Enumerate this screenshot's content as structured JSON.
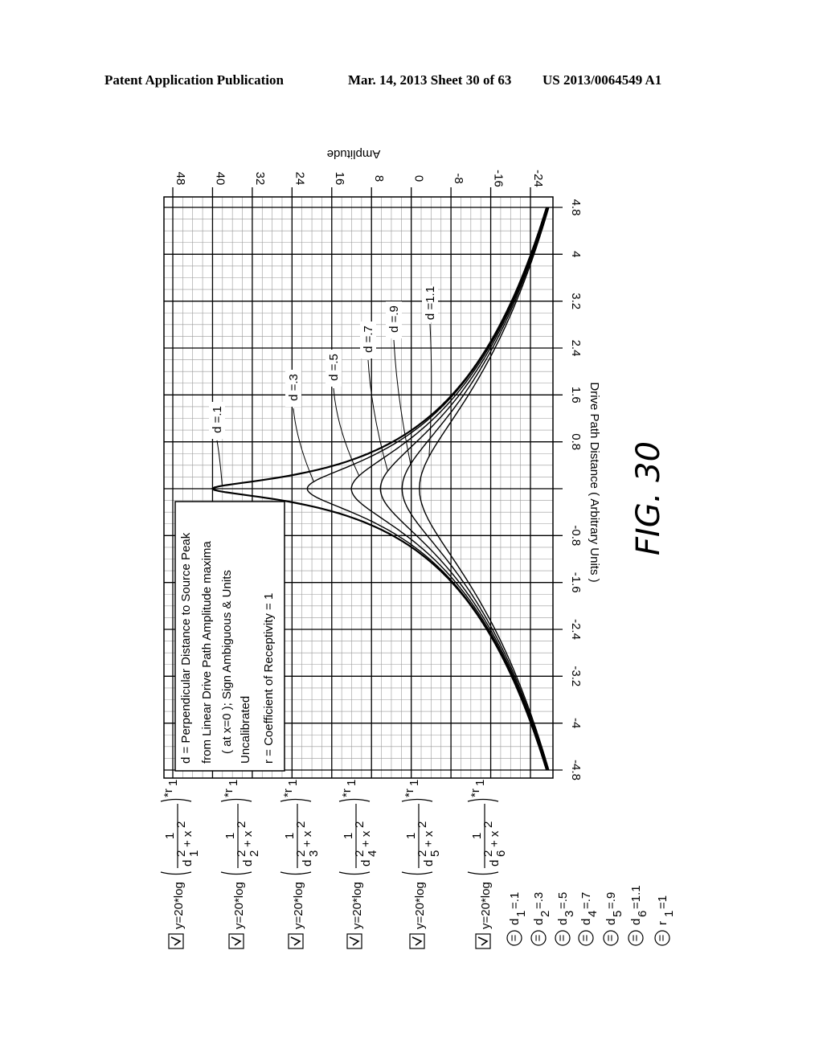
{
  "header": {
    "left": "Patent Application Publication",
    "middle": "Mar. 14, 2013  Sheet 30 of 63",
    "right": "US 2013/0064549 A1"
  },
  "figure_label": "FIG. 30",
  "legend_box": {
    "lines": [
      "d = Perpendicular Distance to Source Peak",
      "from Linear Drive Path Amplitude maxima",
      "( at x=0 );  Sign Ambiguous & Units",
      "Uncalibrated",
      "r = Coefficient of Receptivity = 1"
    ]
  },
  "equations": [
    {
      "checked": true,
      "text": "y=20*log( 1 / (d1² + x²) )*r1",
      "prefix": "y=20*log",
      "d_index": "1",
      "suffix": "*r",
      "r_index": "1"
    },
    {
      "checked": true,
      "text": "y=20*log( 1 / (d2² + x²) )*r1",
      "prefix": "y=20*log",
      "d_index": "2",
      "suffix": "*r",
      "r_index": "1"
    },
    {
      "checked": true,
      "text": "y=20*log( 1 / (d3² + x²) )*r1",
      "prefix": "y=20*log",
      "d_index": "3",
      "suffix": "*r",
      "r_index": "1"
    },
    {
      "checked": true,
      "text": "y=20*log( 1 / (d4² + x²) )*r1",
      "prefix": "y=20*log",
      "d_index": "4",
      "suffix": "*r",
      "r_index": "1"
    },
    {
      "checked": true,
      "text": "y=20*log( 1 / (d5² + x²) )*r1",
      "prefix": "y=20*log",
      "d_index": "5",
      "suffix": "*r",
      "r_index": "1"
    },
    {
      "checked": true,
      "text": "y=20*log( 1 / (d6² + x²) )*r1",
      "prefix": "y=20*log",
      "d_index": "6",
      "suffix": "*r",
      "r_index": "1"
    }
  ],
  "parameters": [
    {
      "name": "d",
      "index": "1",
      "value": "=.1"
    },
    {
      "name": "d",
      "index": "2",
      "value": "=.3"
    },
    {
      "name": "d",
      "index": "3",
      "value": "=.5"
    },
    {
      "name": "d",
      "index": "4",
      "value": "=.7"
    },
    {
      "name": "d",
      "index": "5",
      "value": "=.9"
    },
    {
      "name": "d",
      "index": "6",
      "value": "=1.1"
    },
    {
      "name": "r",
      "index": "1",
      "value": "=1"
    }
  ],
  "chart_data": {
    "type": "line",
    "orientation": "rotated-90-clockwise",
    "title": "",
    "xlabel": "Drive Path Distance  ( Arbitrary Units )",
    "ylabel": "Amplitude",
    "xlim": [
      -4.8,
      4.8
    ],
    "ylim": [
      -24,
      48
    ],
    "x_ticks": [
      "-4.8",
      "-4",
      "-3.2",
      "-2.4",
      "-1.6",
      "-0.8",
      "0.8",
      "1.6",
      "2.4",
      "3.2",
      "4",
      "4.8"
    ],
    "x_tick_values": [
      -4.8,
      -4,
      -3.2,
      -2.4,
      -1.6,
      -0.8,
      0.8,
      1.6,
      2.4,
      3.2,
      4,
      4.8
    ],
    "y_ticks": [
      "48",
      "40",
      "32",
      "24",
      "16",
      "8",
      "0",
      "-8",
      "-16",
      "-24"
    ],
    "y_tick_values": [
      48,
      40,
      32,
      24,
      16,
      8,
      0,
      -8,
      -16,
      -24
    ],
    "grid": true,
    "formula": "y = 20*log10(1/(d^2 + x^2))*r",
    "r": 1,
    "series": [
      {
        "name": "d =.1",
        "d": 0.1,
        "peak_y": 40
      },
      {
        "name": "d =.3",
        "d": 0.3,
        "peak_y": 20.9
      },
      {
        "name": "d =.5",
        "d": 0.5,
        "peak_y": 12.0
      },
      {
        "name": "d =.7",
        "d": 0.7,
        "peak_y": 6.2
      },
      {
        "name": "d =.9",
        "d": 0.9,
        "peak_y": 1.8
      },
      {
        "name": "d =1.1",
        "d": 1.1,
        "peak_y": -1.7
      }
    ],
    "curve_labels": [
      "d =.1",
      "d =.3",
      "d =.5",
      "d =.7",
      "d =.9",
      "d =1.1"
    ]
  }
}
